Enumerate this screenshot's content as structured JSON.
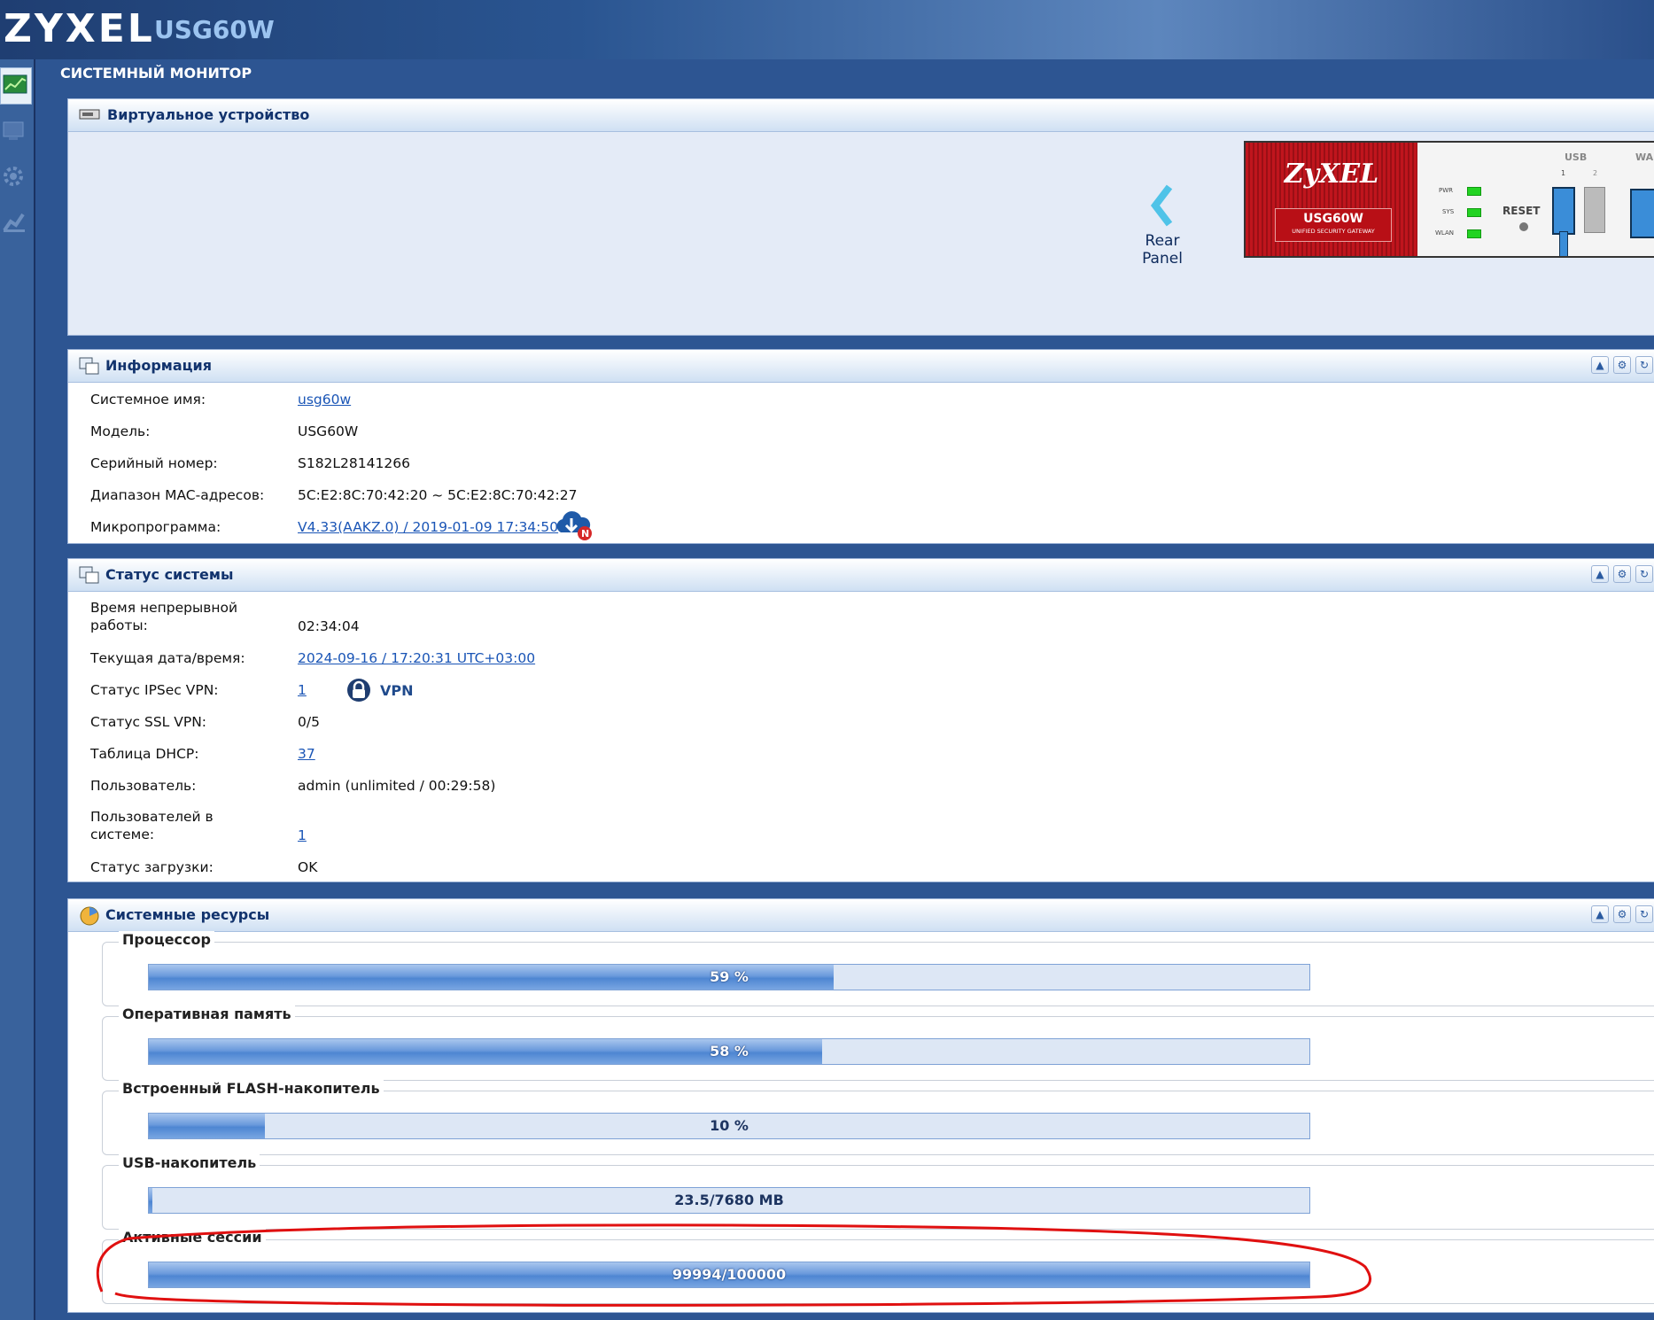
{
  "header": {
    "brand": "ZYXEL",
    "model": "USG60W"
  },
  "page_title": "СИСТЕМНЫЙ МОНИТОР",
  "nav_icons": [
    "dashboard-icon",
    "monitor-icon",
    "configuration-icon",
    "maintenance-icon"
  ],
  "virtual_device": {
    "title": "Виртуальное устройство",
    "rear_panel": [
      "Rear",
      "Panel"
    ],
    "device_logo": "ZyXEL",
    "device_model": "USG60W",
    "device_subtitle": "UNIFIED SECURITY GATEWAY",
    "leds": [
      "PWR",
      "SYS",
      "WLAN"
    ],
    "reset_label": "RESET",
    "usb_label": "USB",
    "usb_ports": [
      "1",
      "2"
    ],
    "wan_label": "WA"
  },
  "info": {
    "title": "Информация",
    "rows": [
      {
        "label": "Системное имя:",
        "value": "usg60w"
      },
      {
        "label": "Модель:",
        "value": "USG60W"
      },
      {
        "label": "Серийный номер:",
        "value": "S182L28141266"
      },
      {
        "label": "Диапазон MAC-адресов:",
        "value": "5C:E2:8C:70:42:20 ~ 5C:E2:8C:70:42:27"
      },
      {
        "label": "Микропрограмма:",
        "value": "V4.33(AAKZ.0) / 2019-01-09 17:34:50"
      }
    ]
  },
  "status": {
    "title": "Статус системы",
    "rows": [
      {
        "label_line1": "Время непрерывной",
        "label_line2": "работы:",
        "value": "02:34:04"
      },
      {
        "label": "Текущая дата/время:",
        "value": "2024-09-16 / 17:20:31 UTC+03:00"
      },
      {
        "label": "Статус IPSec VPN:",
        "value": "1",
        "badge": "VPN"
      },
      {
        "label": "Статус SSL VPN:",
        "value": "0/5"
      },
      {
        "label": "Таблица DHCP:",
        "value": "37"
      },
      {
        "label": "Пользователь:",
        "value": "admin (unlimited / 00:29:58)"
      },
      {
        "label_line1": "Пользователей в",
        "label_line2": "системе:",
        "value": "1"
      },
      {
        "label": "Статус загрузки:",
        "value": "OK"
      }
    ]
  },
  "resources": {
    "title": "Системные ресурсы",
    "items": [
      {
        "label": "Процессор",
        "text": "59 %",
        "fill": 0.59
      },
      {
        "label": "Оперативная память",
        "text": "58 %",
        "fill": 0.58
      },
      {
        "label": "Встроенный FLASH-накопитель",
        "text": "10 %",
        "fill": 0.1
      },
      {
        "label": "USB-накопитель",
        "text": "23.5/7680 MB",
        "fill": 0.003
      },
      {
        "label": "Активные сессии",
        "text": "99994/100000",
        "fill": 0.99994
      }
    ]
  },
  "colors": {
    "accent": "#2d5592",
    "bar_fill": "#4e86d2",
    "annotation": "#e01010"
  }
}
